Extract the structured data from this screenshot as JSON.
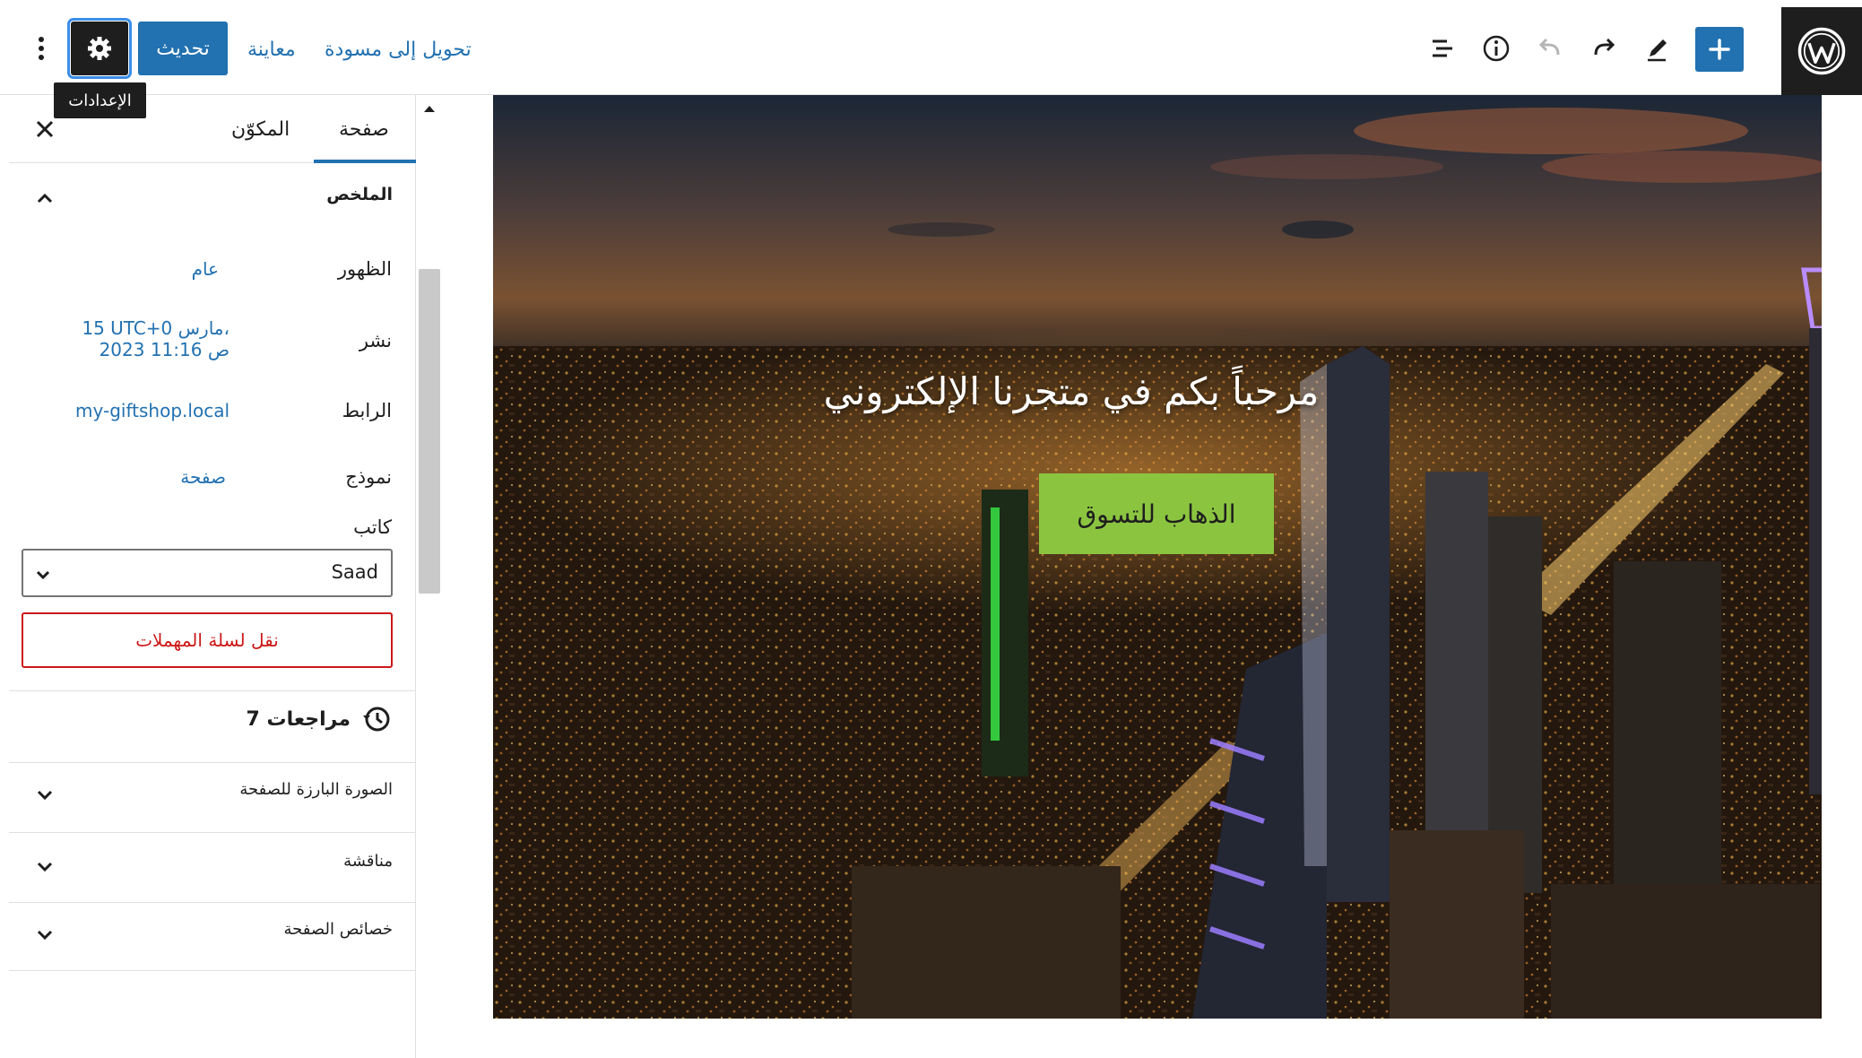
{
  "toolbar": {
    "convert_to_draft": "تحويل إلى مسودة",
    "preview": "معاينة",
    "update": "تحديث",
    "settings_tooltip": "الإعدادات",
    "icons": [
      "wordpress-icon",
      "plus-icon",
      "pencil-icon",
      "redo-icon",
      "undo-icon",
      "info-icon",
      "list-view-icon",
      "gear-icon",
      "kebab-menu-icon"
    ]
  },
  "sidebar": {
    "tabs": {
      "page": "صفحة",
      "block": "المكوّن"
    },
    "summary": {
      "title": "الملخص",
      "rows": [
        {
          "label": "الظهور",
          "value": "عام"
        },
        {
          "label": "نشر",
          "value_line1": "15 UTC+0 مارس،",
          "value_line2": "2023 11:16 ص"
        },
        {
          "label": "الرابط",
          "value": "my-giftshop.local"
        },
        {
          "label": "نموذج",
          "value": "صفحة"
        }
      ],
      "author_label": "كاتب",
      "author_value": "Saad",
      "trash_button": "نقل لسلة المهملات"
    },
    "revisions": "7 مراجعات",
    "panels": [
      {
        "title": "الصورة البارزة للصفحة"
      },
      {
        "title": "مناقشة"
      },
      {
        "title": "خصائص الصفحة"
      }
    ]
  },
  "canvas": {
    "cover_heading": "مرحباً بكم في متجرنا الإلكتروني",
    "cover_button": "الذهاب للتسوق"
  },
  "colors": {
    "accent": "#2271b1",
    "danger": "#cc1818",
    "dark": "#1e1e1e",
    "cover_button": "#8bc540"
  }
}
